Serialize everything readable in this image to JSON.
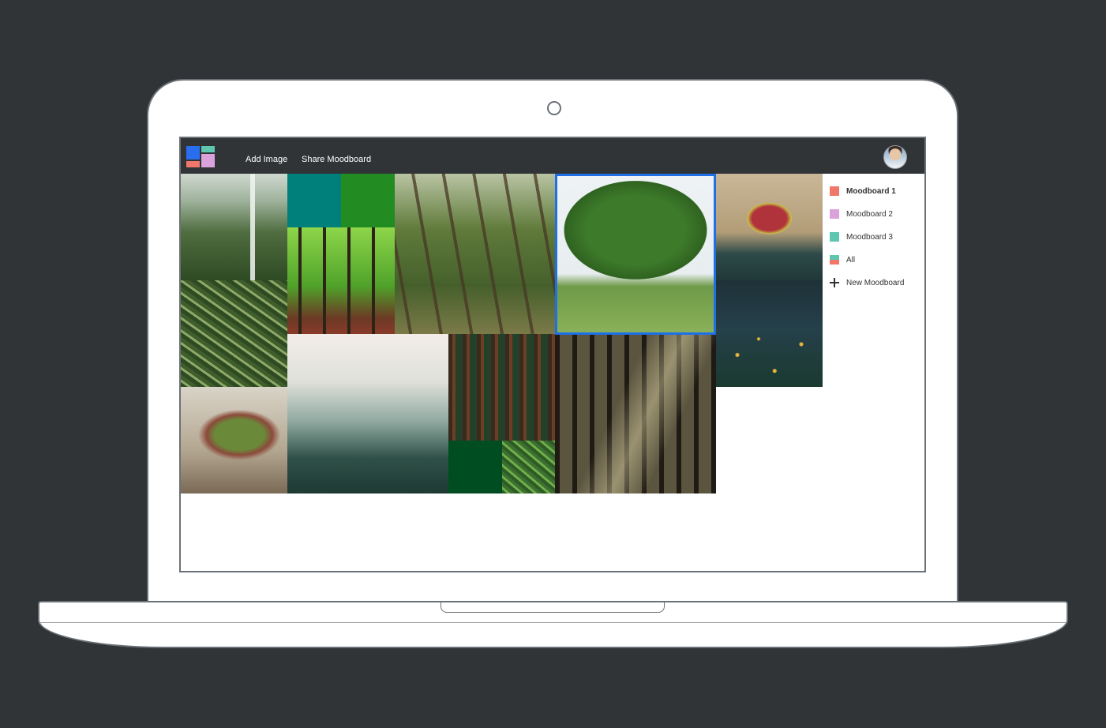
{
  "app": {
    "nav": {
      "add_image": "Add Image",
      "share_moodboard": "Share Moodboard"
    },
    "logo_colors": [
      "#2a6ef0",
      "#5fc6b0",
      "#f0776a",
      "#dba1db"
    ],
    "accent": "#1f6fe6"
  },
  "sidebar": {
    "items": [
      {
        "label": "Moodboard 1",
        "color": "#f0776a",
        "active": true
      },
      {
        "label": "Moodboard 2",
        "color": "#dba1db",
        "active": false
      },
      {
        "label": "Moodboard 3",
        "color": "#5fc6b0",
        "active": false
      },
      {
        "label": "All",
        "color": "mixed",
        "active": false
      },
      {
        "label": "New Moodboard",
        "icon": "plus-icon",
        "active": false
      }
    ]
  },
  "moodboard": {
    "tiles": [
      {
        "name": "waterfall-jungle-image"
      },
      {
        "name": "palm-leaves-image"
      },
      {
        "name": "mossy-mushroom-image"
      },
      {
        "name": "teal-color-swatch",
        "color": "#00807a"
      },
      {
        "name": "green-color-swatch",
        "color": "#228b22"
      },
      {
        "name": "bright-green-forest-image"
      },
      {
        "name": "twisted-trees-forest-image"
      },
      {
        "name": "large-tree-field-image"
      },
      {
        "name": "venus-flytrap-image"
      },
      {
        "name": "fireflies-forest-image"
      },
      {
        "name": "foggy-pine-forest-image"
      },
      {
        "name": "red-pine-forest-image"
      },
      {
        "name": "dark-green-color-swatch",
        "color": "#004d22"
      },
      {
        "name": "fern-image"
      },
      {
        "name": "sunbeam-forest-image"
      }
    ]
  }
}
